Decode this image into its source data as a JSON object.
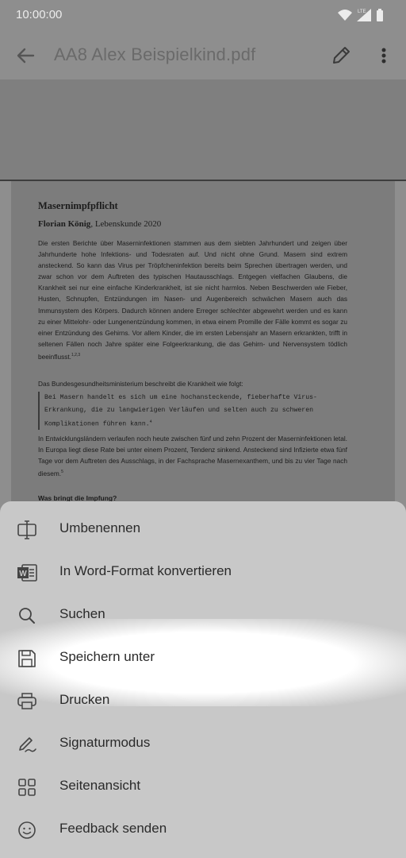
{
  "status_bar": {
    "time": "10:00:00",
    "network": "LTE"
  },
  "app_bar": {
    "title": "AA8 Alex Beispielkind.pdf"
  },
  "document": {
    "heading": "Masernimpfpflicht",
    "author_name": "Florian König",
    "author_rest": ", Lebenskunde 2020",
    "paragraph1": "Die ersten Berichte über Maserninfektionen stammen aus dem siebten Jahrhundert und zeigen über Jahrhunderte hohe Infektions- und Todesraten auf. Und nicht ohne Grund. Masern sind extrem ansteckend. So kann das Virus per Tröpfcheninfektion bereits beim Sprechen übertragen werden, und zwar schon vor dem Auftreten des typischen Hautausschlags. Entgegen vielfachen Glaubens, die Krankheit sei nur eine einfache Kinderkrankheit, ist sie nicht harmlos. Neben Beschwerden wie Fieber, Husten, Schnupfen, Entzündungen im Nasen- und Augenbereich schwächen Masern auch das Immunsystem des Körpers. Dadurch können andere Erreger schlechter abgewehrt werden und es kann zu einer Mittelohr- oder Lungenentzündung kommen, in etwa einem Promille der Fälle kommt es sogar zu einer Entzündung des Gehirns. Vor allem Kinder, die im ersten Lebensjahr an Masern erkrankten, trifft in seltenen Fällen noch Jahre später eine Folgeerkrankung, die das Gehirn- und Nervensystem tödlich beeinflusst.",
    "paragraph1_sup": "1,2,3",
    "paragraph2": "Das Bundesgesundheitsministerium beschreibt die Krankheit wie folgt:",
    "quote": "Bei Masern handelt es sich um eine hochansteckende, fieberhafte Virus-Erkrankung, die zu langwierigen Verläufen und selten auch zu schweren Komplikationen führen kann.",
    "quote_sup": "4",
    "paragraph3": "In Entwicklungsländern verlaufen noch heute zwischen fünf und zehn Prozent der Maserninfektionen letal. In Europa liegt diese Rate bei unter einem Prozent, Tendenz sinkend. Ansteckend sind Infizierte etwa fünf Tage vor dem Auftreten des Ausschlags, in der Fachsprache Masernexanthem, und bis zu vier Tage nach diesem.",
    "paragraph3_sup": "5",
    "subheading": "Was bringt die Impfung?"
  },
  "menu": {
    "items": [
      {
        "label": "Umbenennen",
        "icon": "rename-icon"
      },
      {
        "label": "In Word-Format konvertieren",
        "icon": "word-icon"
      },
      {
        "label": "Suchen",
        "icon": "search-icon"
      },
      {
        "label": "Speichern unter",
        "icon": "save-icon"
      },
      {
        "label": "Drucken",
        "icon": "print-icon"
      },
      {
        "label": "Signaturmodus",
        "icon": "signature-icon"
      },
      {
        "label": "Seitenansicht",
        "icon": "grid-icon"
      },
      {
        "label": "Feedback senden",
        "icon": "smiley-icon"
      }
    ]
  }
}
